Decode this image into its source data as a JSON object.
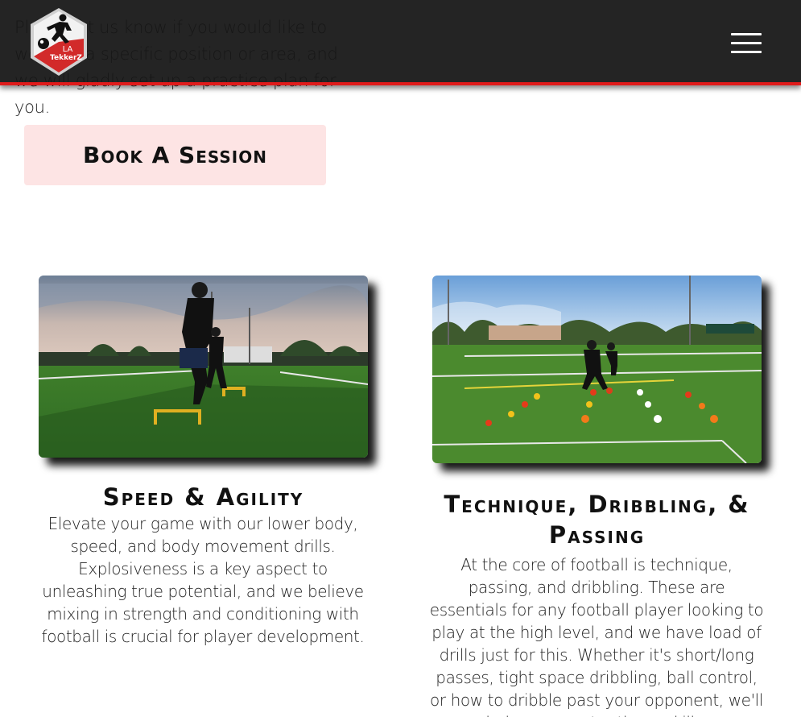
{
  "intro": {
    "text": "Please let us know if you would like to work on a specific position or area, and we will gladly set up a practice plan for you."
  },
  "header": {
    "logo_text_line1": "LA",
    "logo_text_line2": "TekkerZ",
    "menu_icon": "hamburger-menu-icon",
    "accent_color": "#e01b1b"
  },
  "cta": {
    "book_label": "Book A Session"
  },
  "cards": [
    {
      "title": "Speed & Agility",
      "text": "Elevate your game with our lower body, speed, and body movement drills. Explosiveness is a key aspect to unleashing true potential, and we believe mixing in strength and conditioning with football is crucial for player development."
    },
    {
      "title": "Technique, Dribbling, & Passing",
      "text": "At the core of football is technique, passing, and dribbling. These are essentials for any football player looking to play at the high level, and we have load of drills just for this. Whether it's short/long passes, tight space dribbling, ball control, or how to dribble past your opponent, we'll help you master these skills."
    }
  ]
}
